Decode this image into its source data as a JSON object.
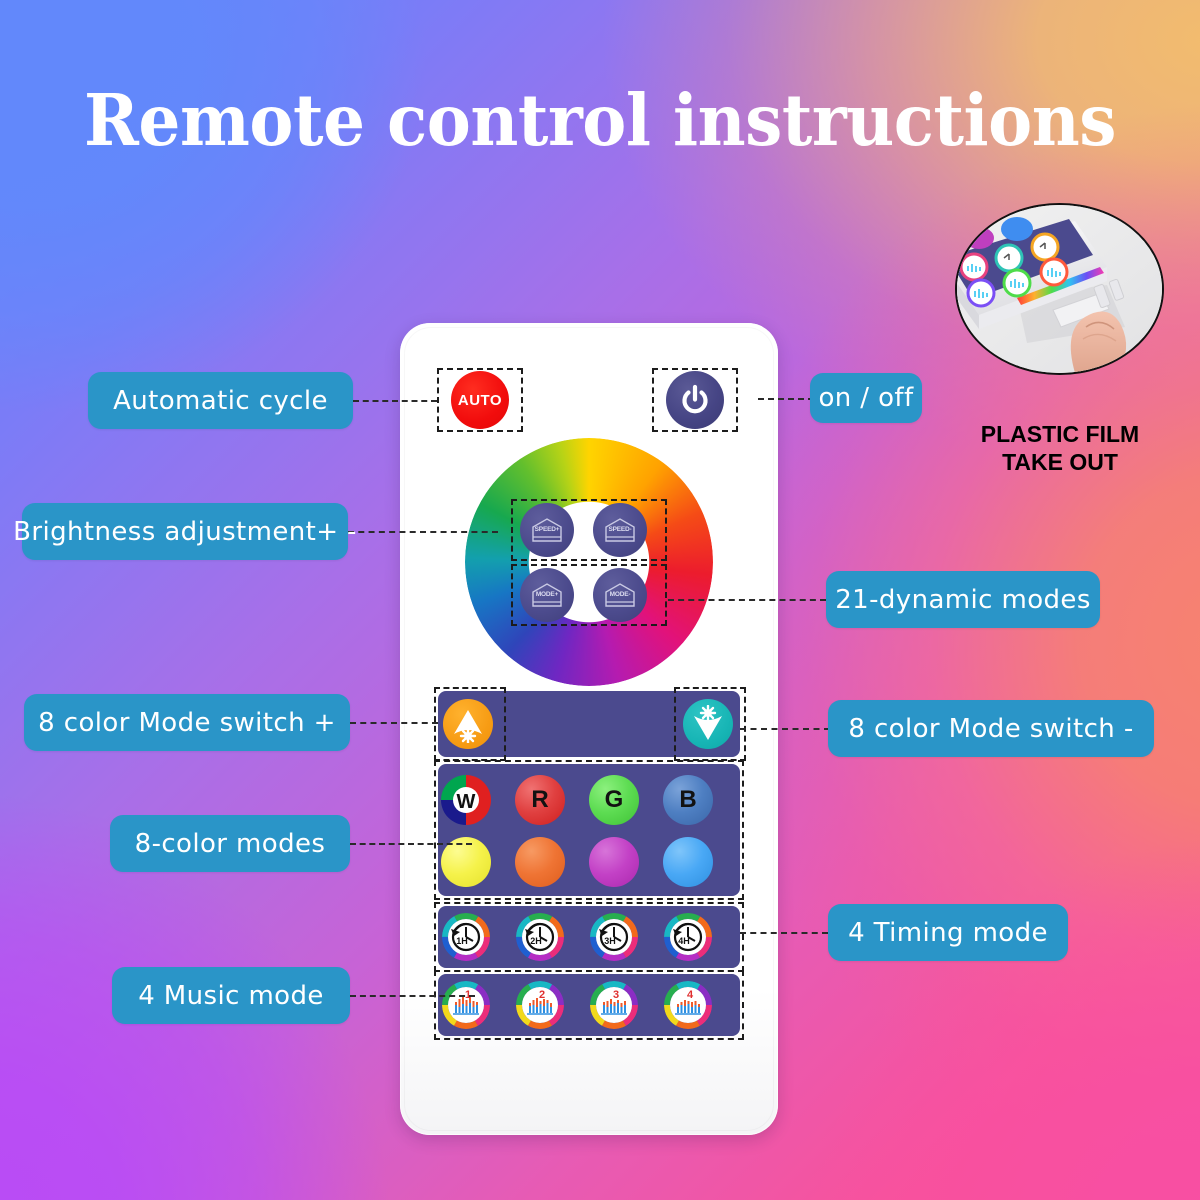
{
  "page": {
    "title": "Remote control instructions",
    "background": {
      "top_left": "#6288fb",
      "top_right": "#f2bc6e",
      "bottom_left": "#b94bf6",
      "bottom_right": "#f84fa4"
    },
    "accent_pill_color": "#2a95c8"
  },
  "callouts": {
    "automatic_cycle": "Automatic cycle",
    "brightness": "Brightness adjustment+ -",
    "color_mode_plus": "8 color Mode switch +",
    "color_modes": "8-color modes",
    "music_mode": "4 Music mode",
    "on_off": "on / off",
    "dynamic_modes": "21-dynamic modes",
    "color_mode_minus": "8 color Mode switch -",
    "timing_mode": "4 Timing mode"
  },
  "photo_inset": {
    "caption_line1": "PLASTIC FILM",
    "caption_line2": "TAKE OUT",
    "icon": "finger-pulling-film-photo"
  },
  "remote": {
    "auto_button": {
      "label": "AUTO",
      "color": "#f20d0d",
      "icon": "auto-button"
    },
    "power_button": {
      "label": "",
      "color": "#464585",
      "icon": "power-icon"
    },
    "color_wheel": {
      "icon": "color-wheel"
    },
    "center_buttons": [
      {
        "label": "SPEED+",
        "icon": "speed-up-icon"
      },
      {
        "label": "SPEED-",
        "icon": "speed-down-icon"
      },
      {
        "label": "MODE+",
        "icon": "mode-up-icon"
      },
      {
        "label": "MODE-",
        "icon": "mode-down-icon"
      }
    ],
    "brightness_buttons": [
      {
        "label": "",
        "icon": "brightness-up-icon",
        "color": "#f79c14"
      },
      {
        "label": "",
        "icon": "brightness-down-icon",
        "color": "#17b5b5"
      }
    ],
    "color_buttons": [
      {
        "label": "W",
        "icon": "white-color-button",
        "color": "#ffffff"
      },
      {
        "label": "R",
        "icon": "red-color-button",
        "color": "#e63b3b"
      },
      {
        "label": "G",
        "icon": "green-color-button",
        "color": "#5ddc52"
      },
      {
        "label": "B",
        "icon": "blue-color-button",
        "color": "#4e7fc2"
      },
      {
        "label": "",
        "icon": "yellow-color-button",
        "color": "#f5f24a"
      },
      {
        "label": "",
        "icon": "orange-color-button",
        "color": "#ef7434"
      },
      {
        "label": "",
        "icon": "magenta-color-button",
        "color": "#c341c6"
      },
      {
        "label": "",
        "icon": "cyan-blue-color-button",
        "color": "#49a8f5"
      }
    ],
    "timer_buttons": [
      {
        "label": "1H",
        "icon": "timer-1h-icon"
      },
      {
        "label": "2H",
        "icon": "timer-2h-icon"
      },
      {
        "label": "3H",
        "icon": "timer-3h-icon"
      },
      {
        "label": "4H",
        "icon": "timer-4h-icon"
      }
    ],
    "music_buttons": [
      {
        "label": "1",
        "icon": "music-mode-1-icon"
      },
      {
        "label": "2",
        "icon": "music-mode-2-icon"
      },
      {
        "label": "3",
        "icon": "music-mode-3-icon"
      },
      {
        "label": "4",
        "icon": "music-mode-4-icon"
      }
    ]
  }
}
